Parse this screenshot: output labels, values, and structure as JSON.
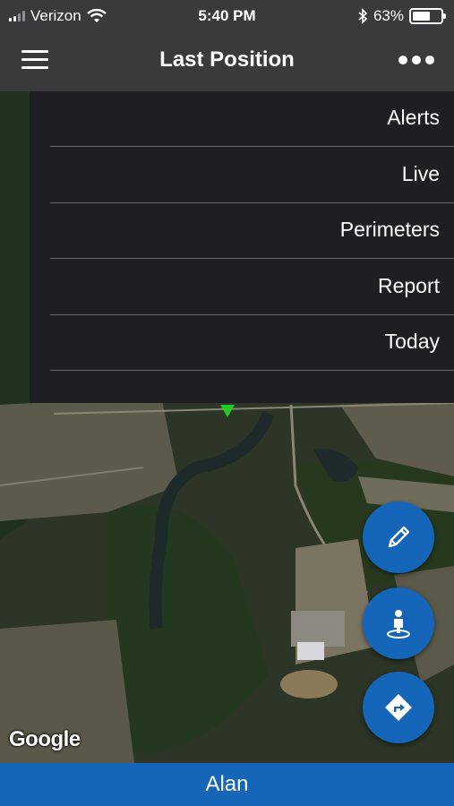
{
  "status_bar": {
    "carrier": "Verizon",
    "time": "5:40 PM",
    "battery_percent": "63%",
    "battery_level": 0.63,
    "icons": [
      "signal-icon",
      "wifi-icon",
      "bluetooth-icon",
      "battery-icon"
    ]
  },
  "header": {
    "title": "Last Position",
    "menu_icon": "hamburger-icon",
    "more_icon": "ellipsis-icon"
  },
  "dropdown": {
    "items": [
      {
        "label": "Alerts"
      },
      {
        "label": "Live"
      },
      {
        "label": "Perimeters"
      },
      {
        "label": "Report"
      },
      {
        "label": "Today"
      }
    ]
  },
  "map": {
    "attribution": "Google",
    "marker_color": "#22cc22"
  },
  "fabs": [
    {
      "icon": "pencil-icon"
    },
    {
      "icon": "person-location-icon"
    },
    {
      "icon": "directions-icon"
    }
  ],
  "bottom_bar": {
    "label": "Alan"
  },
  "colors": {
    "header_bg": "#3a3a3c",
    "menu_bg": "#1f1f23",
    "accent": "#1565b8"
  }
}
